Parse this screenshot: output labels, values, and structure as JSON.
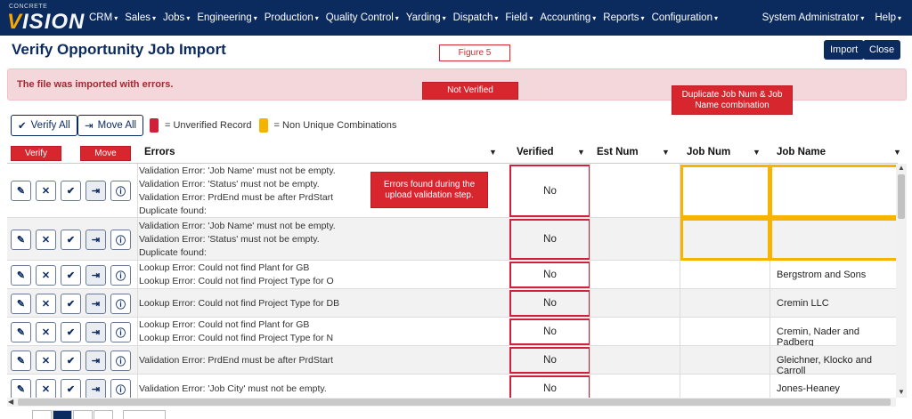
{
  "nav": {
    "logo_small": "CONCRETE",
    "logo_big_v": "V",
    "logo_big_rest": "ISION",
    "menu": [
      {
        "label": "CRM"
      },
      {
        "label": "Sales"
      },
      {
        "label": "Jobs"
      },
      {
        "label": "Engineering"
      },
      {
        "label": "Production"
      },
      {
        "label": "Quality Control"
      },
      {
        "label": "Yarding"
      },
      {
        "label": "Dispatch"
      },
      {
        "label": "Field"
      },
      {
        "label": "Accounting"
      },
      {
        "label": "Reports"
      },
      {
        "label": "Configuration"
      }
    ],
    "user": "System Administrator",
    "help": "Help",
    "caret": "▾"
  },
  "page": {
    "title": "Verify Opportunity Job Import",
    "import_label": "Import",
    "close_label": "Close"
  },
  "callouts": {
    "figure": "Figure 5",
    "not_verified": "Not Verified",
    "duplicate": "Duplicate Job Num & Job Name combination",
    "verify": "Verify",
    "move": "Move",
    "errors_found": "Errors found during the upload validation step."
  },
  "alert": "The file was imported with errors.",
  "toolbar": {
    "verify_all": "Verify All",
    "move_all": "Move All",
    "legend_unverified": "= Unverified Record",
    "legend_nonunique": "= Non Unique Combinations"
  },
  "colors": {
    "navy": "#0b2a5e",
    "unverified": "#d0203a",
    "nonunique": "#f5b400"
  },
  "columns": {
    "errors": "Errors",
    "verified": "Verified",
    "est_num": "Est Num",
    "job_num": "Job Num",
    "job_name": "Job Name"
  },
  "rows": [
    {
      "errors": [
        "Validation Error: 'Job Name' must not be empty.",
        "Validation Error: 'Status' must not be empty.",
        "Validation Error: PrdEnd must be after PrdStart",
        "Duplicate found:"
      ],
      "verified": "No",
      "job_name": ""
    },
    {
      "errors": [
        "Validation Error: 'Job Name' must not be empty.",
        "Validation Error: 'Status' must not be empty.",
        "Duplicate found:"
      ],
      "verified": "No",
      "job_name": ""
    },
    {
      "errors": [
        "Lookup Error: Could not find Plant for GB",
        "Lookup Error: Could not find Project Type for O"
      ],
      "verified": "No",
      "job_name": "Bergstrom and Sons"
    },
    {
      "errors": [
        "Lookup Error: Could not find Project Type for DB"
      ],
      "verified": "No",
      "job_name": "Cremin LLC"
    },
    {
      "errors": [
        "Lookup Error: Could not find Plant for GB",
        "Lookup Error: Could not find Project Type for N"
      ],
      "verified": "No",
      "job_name": "Cremin, Nader and Padberg"
    },
    {
      "errors": [
        "Validation Error: PrdEnd must be after PrdStart"
      ],
      "verified": "No",
      "job_name": "Gleichner, Klocko and Carroll"
    },
    {
      "errors": [
        "Validation Error: 'Job City' must not be empty."
      ],
      "verified": "No",
      "job_name": "Jones-Heaney"
    }
  ],
  "icons": {
    "edit": "pencil-icon",
    "delete": "x-icon",
    "verify": "check-icon",
    "move": "move-icon",
    "info": "info-icon",
    "filter": "filter-icon"
  }
}
